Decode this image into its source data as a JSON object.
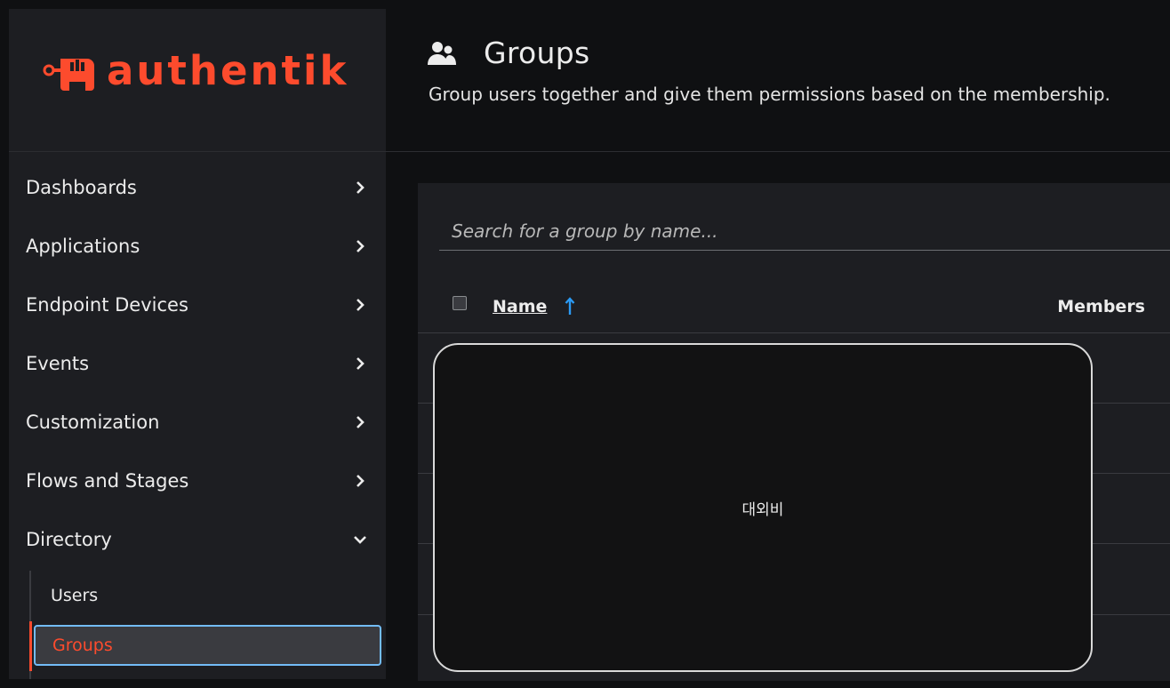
{
  "brand": {
    "name": "authentik",
    "color": "#fd4b2d"
  },
  "sidebar": {
    "items": [
      {
        "label": "Dashboards",
        "icon": "chevron-right-icon"
      },
      {
        "label": "Applications",
        "icon": "chevron-right-icon"
      },
      {
        "label": "Endpoint Devices",
        "icon": "chevron-right-icon"
      },
      {
        "label": "Events",
        "icon": "chevron-right-icon"
      },
      {
        "label": "Customization",
        "icon": "chevron-right-icon"
      },
      {
        "label": "Flows and Stages",
        "icon": "chevron-right-icon"
      },
      {
        "label": "Directory",
        "icon": "chevron-down-icon",
        "expanded": true
      }
    ],
    "subitems": [
      {
        "label": "Users"
      },
      {
        "label": "Groups",
        "active": true
      }
    ],
    "active_color": "#fd4b2d",
    "focus_color": "#73bcf7"
  },
  "header": {
    "icon": "users-icon",
    "title": "Groups",
    "description": "Group users together and give them permissions based on the membership."
  },
  "table": {
    "search_placeholder": "Search for a group by name...",
    "columns": [
      {
        "label": "Name",
        "sortable": true,
        "sort": "ascending"
      },
      {
        "label": "Members"
      }
    ],
    "sort_icon_color": "#2b9af3"
  },
  "redaction": {
    "label": "대외비"
  }
}
